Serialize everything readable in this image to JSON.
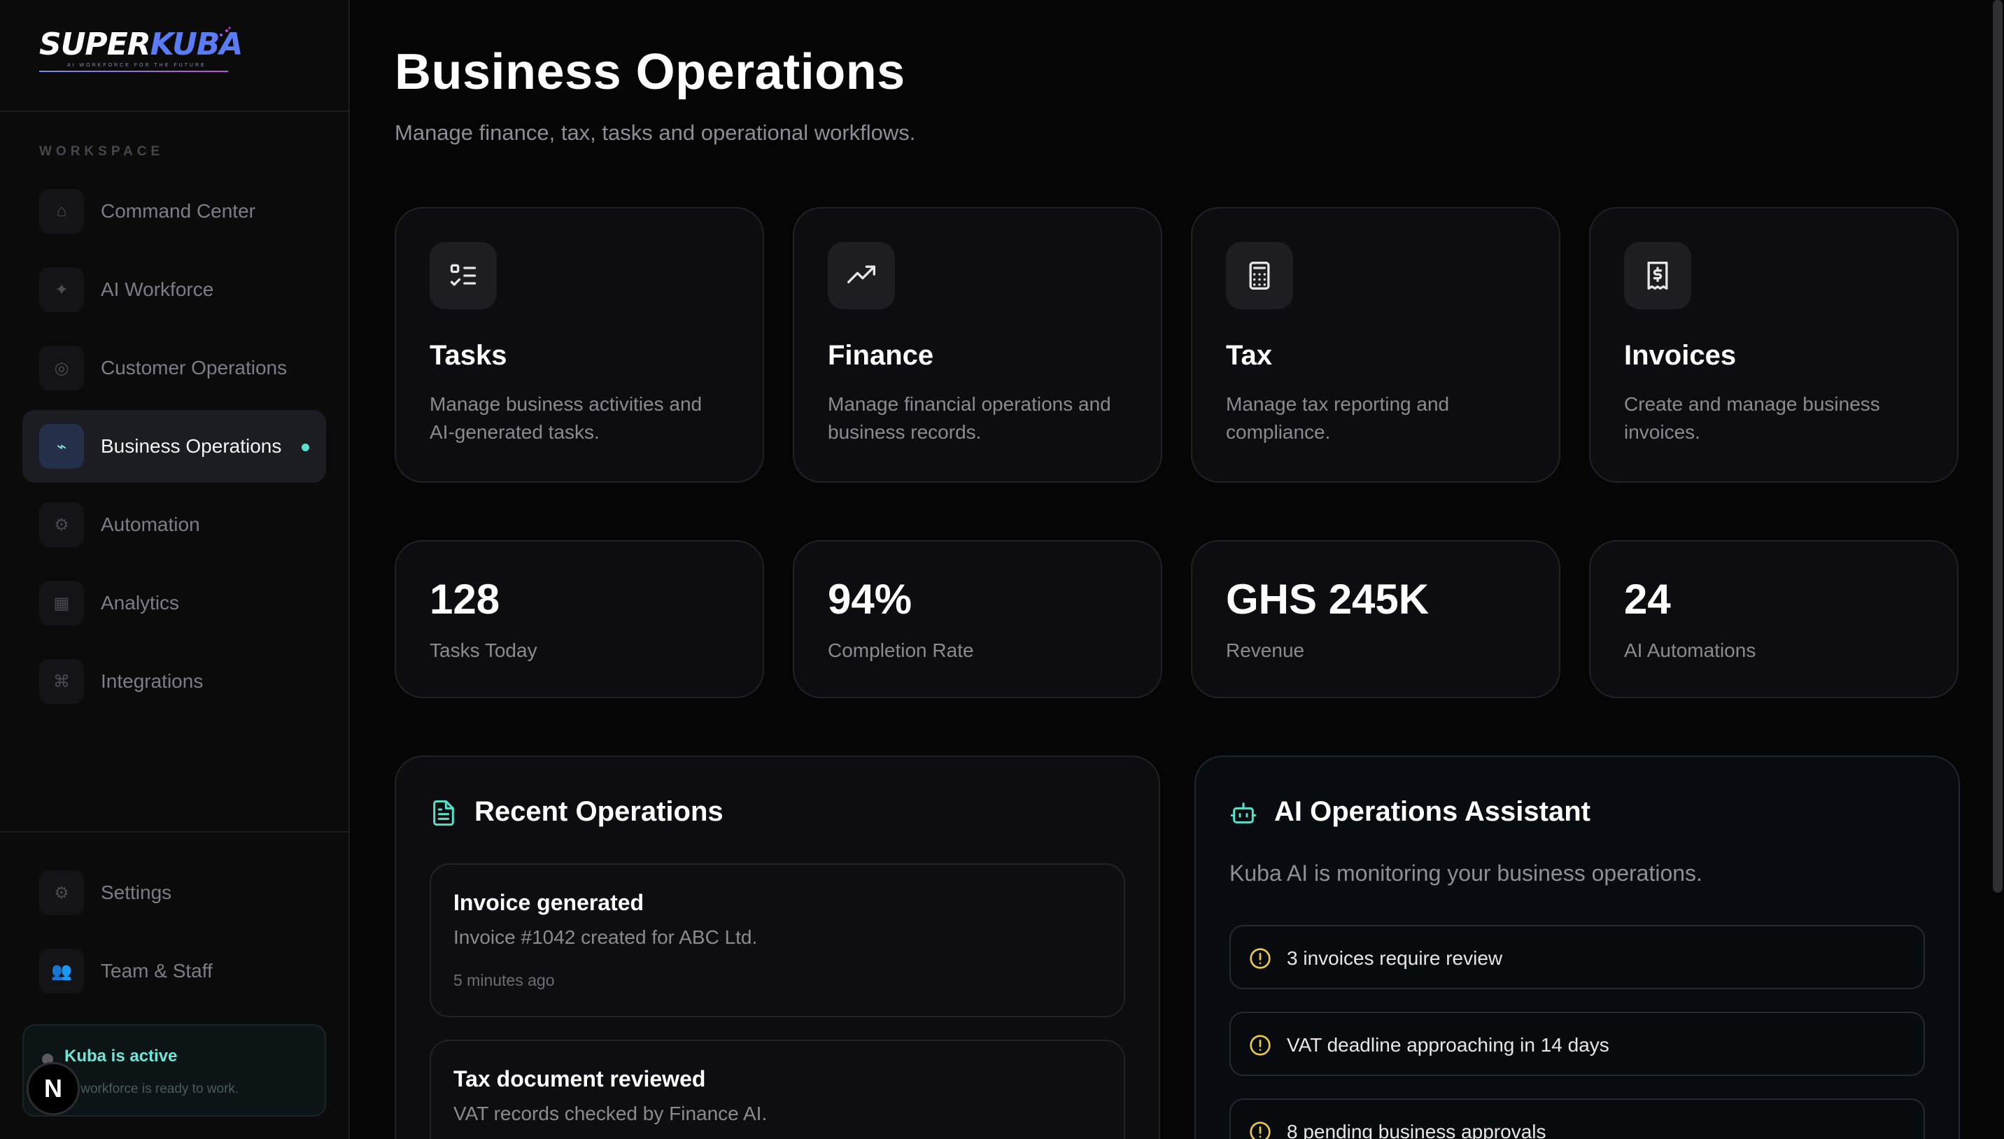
{
  "brand": {
    "name_part1": "SUPER",
    "name_part2": "KUBA",
    "tagline": "AI WORKFORCE FOR THE FUTURE"
  },
  "sidebar": {
    "section_label": "WORKSPACE",
    "items": [
      {
        "label": "Command Center",
        "icon": "home-icon",
        "glyph": "⌂"
      },
      {
        "label": "AI Workforce",
        "icon": "sparkle-icon",
        "glyph": "✦"
      },
      {
        "label": "Customer Operations",
        "icon": "target-icon",
        "glyph": "◎"
      },
      {
        "label": "Business Operations",
        "icon": "pulse-icon",
        "glyph": "⌁",
        "active": true
      },
      {
        "label": "Automation",
        "icon": "gear-icon",
        "glyph": "⚙"
      },
      {
        "label": "Analytics",
        "icon": "chart-icon",
        "glyph": "▦"
      },
      {
        "label": "Integrations",
        "icon": "command-icon",
        "glyph": "⌘"
      }
    ],
    "bottom_items": [
      {
        "label": "Settings",
        "icon": "gear-icon",
        "glyph": "⚙"
      },
      {
        "label": "Team & Staff",
        "icon": "people-icon",
        "glyph": "👥"
      }
    ],
    "status": {
      "title": "Kuba is active",
      "subtitle": "AI workforce is ready to work."
    },
    "badge": "N"
  },
  "header": {
    "title": "Business Operations",
    "subtitle": "Manage finance, tax, tasks and operational workflows."
  },
  "features": [
    {
      "title": "Tasks",
      "desc": "Manage business activities and AI-generated tasks.",
      "icon": "checklist-icon"
    },
    {
      "title": "Finance",
      "desc": "Manage financial operations and business records.",
      "icon": "trending-up-icon"
    },
    {
      "title": "Tax",
      "desc": "Manage tax reporting and compliance.",
      "icon": "calculator-icon"
    },
    {
      "title": "Invoices",
      "desc": "Create and manage business invoices.",
      "icon": "receipt-dollar-icon"
    }
  ],
  "stats": [
    {
      "value": "128",
      "label": "Tasks Today"
    },
    {
      "value": "94%",
      "label": "Completion Rate"
    },
    {
      "value": "GHS 245K",
      "label": "Revenue"
    },
    {
      "value": "24",
      "label": "AI Automations"
    }
  ],
  "recent": {
    "title": "Recent Operations",
    "items": [
      {
        "title": "Invoice generated",
        "desc": "Invoice #1042 created for ABC Ltd.",
        "time": "5 minutes ago"
      },
      {
        "title": "Tax document reviewed",
        "desc": "VAT records checked by Finance AI.",
        "time": ""
      }
    ]
  },
  "assistant": {
    "title": "AI Operations Assistant",
    "subtitle": "Kuba AI is monitoring your business operations.",
    "alerts": [
      {
        "text": "3 invoices require review"
      },
      {
        "text": "VAT deadline approaching in 14 days"
      },
      {
        "text": "8 pending business approvals"
      }
    ]
  },
  "colors": {
    "accent_teal": "#59e0c8",
    "alert_yellow": "#e9c84a",
    "background": "#050505"
  }
}
